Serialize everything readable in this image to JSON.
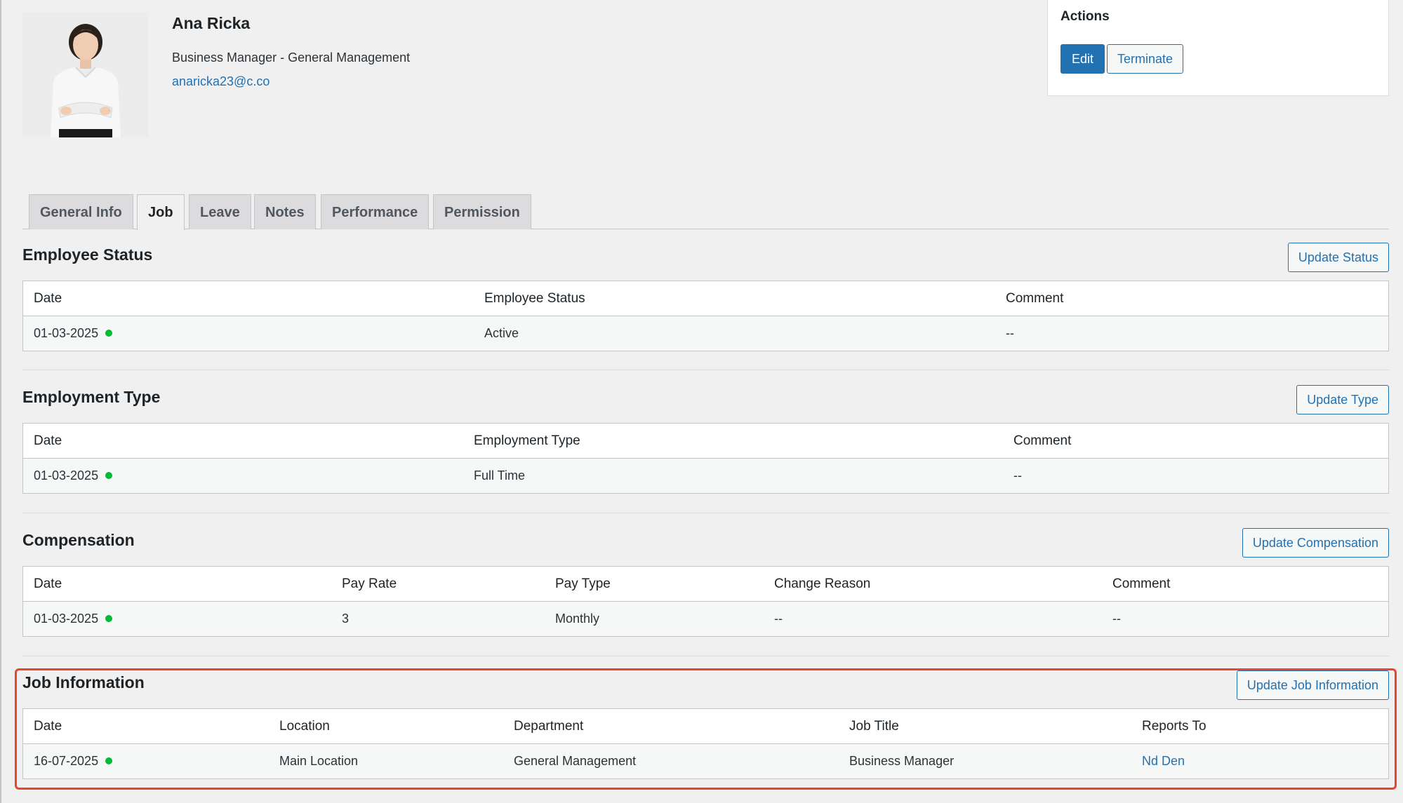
{
  "employee": {
    "name": "Ana Ricka",
    "role": "Business Manager - General Management",
    "email": "anaricka23@c.co"
  },
  "actions": {
    "title": "Actions",
    "edit_label": "Edit",
    "terminate_label": "Terminate"
  },
  "tabs": [
    {
      "label": "General Info",
      "active": false
    },
    {
      "label": "Job",
      "active": true
    },
    {
      "label": "Leave",
      "active": false
    },
    {
      "label": "Notes",
      "active": false
    },
    {
      "label": "Performance",
      "active": false
    },
    {
      "label": "Permission",
      "active": false
    }
  ],
  "sections": {
    "employee_status": {
      "title": "Employee Status",
      "button": "Update Status",
      "columns": [
        "Date",
        "Employee Status",
        "Comment"
      ],
      "rows": [
        [
          "01-03-2025",
          "Active",
          "--"
        ]
      ]
    },
    "employment_type": {
      "title": "Employment Type",
      "button": "Update Type",
      "columns": [
        "Date",
        "Employment Type",
        "Comment"
      ],
      "rows": [
        [
          "01-03-2025",
          "Full Time",
          "--"
        ]
      ]
    },
    "compensation": {
      "title": "Compensation",
      "button": "Update Compensation",
      "columns": [
        "Date",
        "Pay Rate",
        "Pay Type",
        "Change Reason",
        "Comment"
      ],
      "rows": [
        [
          "01-03-2025",
          "3",
          "Monthly",
          "--",
          "--"
        ]
      ]
    },
    "job_information": {
      "title": "Job Information",
      "button": "Update Job Information",
      "columns": [
        "Date",
        "Location",
        "Department",
        "Job Title",
        "Reports To"
      ],
      "rows": [
        [
          "16-07-2025",
          "Main Location",
          "General Management",
          "Business Manager",
          "Nd Den"
        ]
      ]
    }
  },
  "colors": {
    "accent": "#2271b1",
    "status_active": "#00ba37",
    "highlight": "#e8472e"
  }
}
